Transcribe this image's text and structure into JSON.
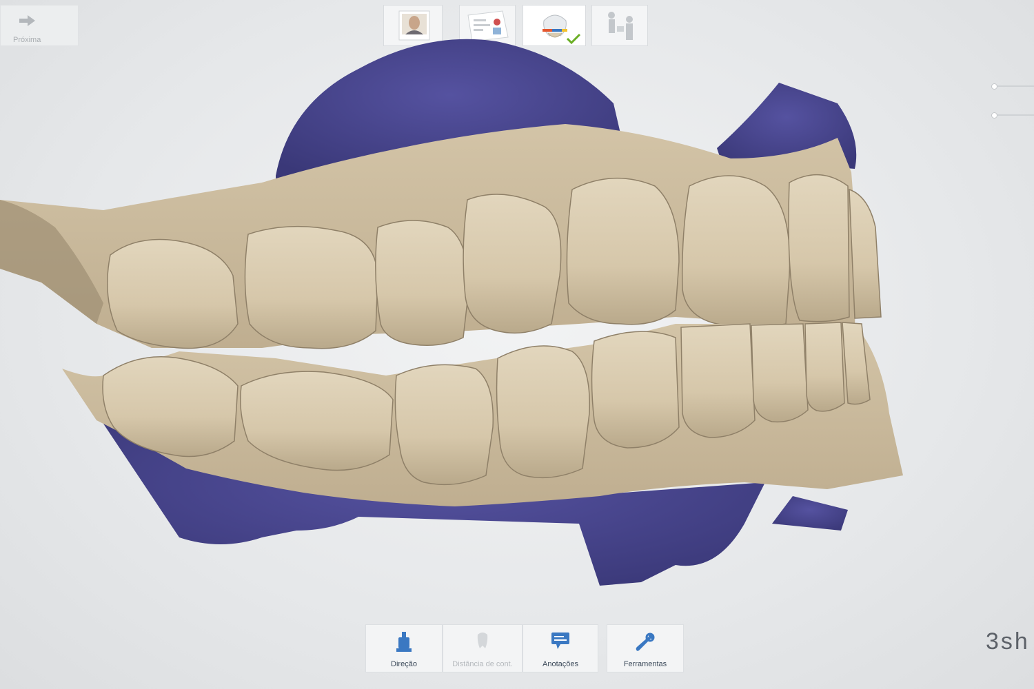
{
  "nav": {
    "next_label": "Próxima"
  },
  "workflow": {
    "steps": [
      {
        "name": "patient-photo",
        "icon": "patient-photo-icon",
        "state": "done"
      },
      {
        "name": "order-form",
        "icon": "order-form-icon",
        "state": "done"
      },
      {
        "name": "scan",
        "icon": "tooth-scan-icon",
        "state": "active",
        "status": "check"
      },
      {
        "name": "send",
        "icon": "send-people-icon",
        "state": "pending"
      }
    ]
  },
  "toolbar": {
    "direction_label": "Direção",
    "contact_distance_label": "Distância de cont.",
    "annotations_label": "Anotações",
    "tools_label": "Ferramentas"
  },
  "brand": {
    "text": "3sh"
  },
  "colors": {
    "tooth": "#d9cbb0",
    "gum_scan": "#48458c",
    "accent": "#3a78c2",
    "check": "#6aae24"
  }
}
